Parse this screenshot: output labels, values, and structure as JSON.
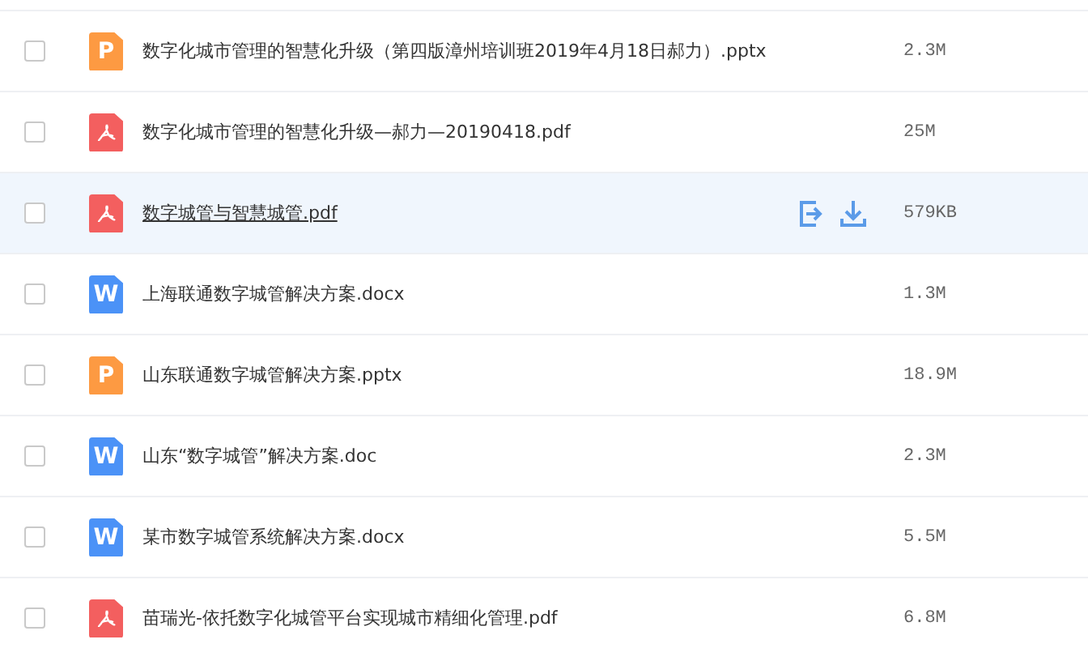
{
  "files": [
    {
      "kind": "ppt",
      "icon_letter": "P",
      "name": "数字化城市管理的智慧化升级（第四版漳州培训班2019年4月18日郝力）.pptx",
      "size": "2.3M",
      "hovered": false,
      "checked": false
    },
    {
      "kind": "pdf",
      "name": "数字化城市管理的智慧化升级—郝力—20190418.pdf",
      "size": "25M",
      "hovered": false,
      "checked": false
    },
    {
      "kind": "pdf",
      "name": "数字城管与智慧城管.pdf",
      "size": "579KB",
      "hovered": true,
      "checked": false
    },
    {
      "kind": "doc",
      "icon_letter": "W",
      "name": "上海联通数字城管解决方案.docx",
      "size": "1.3M",
      "hovered": false,
      "checked": false
    },
    {
      "kind": "ppt",
      "icon_letter": "P",
      "name": "山东联通数字城管解决方案.pptx",
      "size": "18.9M",
      "hovered": false,
      "checked": false
    },
    {
      "kind": "doc",
      "icon_letter": "W",
      "name": "山东“数字城管”解决方案.doc",
      "size": "2.3M",
      "hovered": false,
      "checked": false
    },
    {
      "kind": "doc",
      "icon_letter": "W",
      "name": "某市数字城管系统解决方案.docx",
      "size": "5.5M",
      "hovered": false,
      "checked": false
    },
    {
      "kind": "pdf",
      "name": "苗瑞光-依托数字化城管平台实现城市精细化管理.pdf",
      "size": "6.8M",
      "hovered": false,
      "checked": false
    }
  ]
}
